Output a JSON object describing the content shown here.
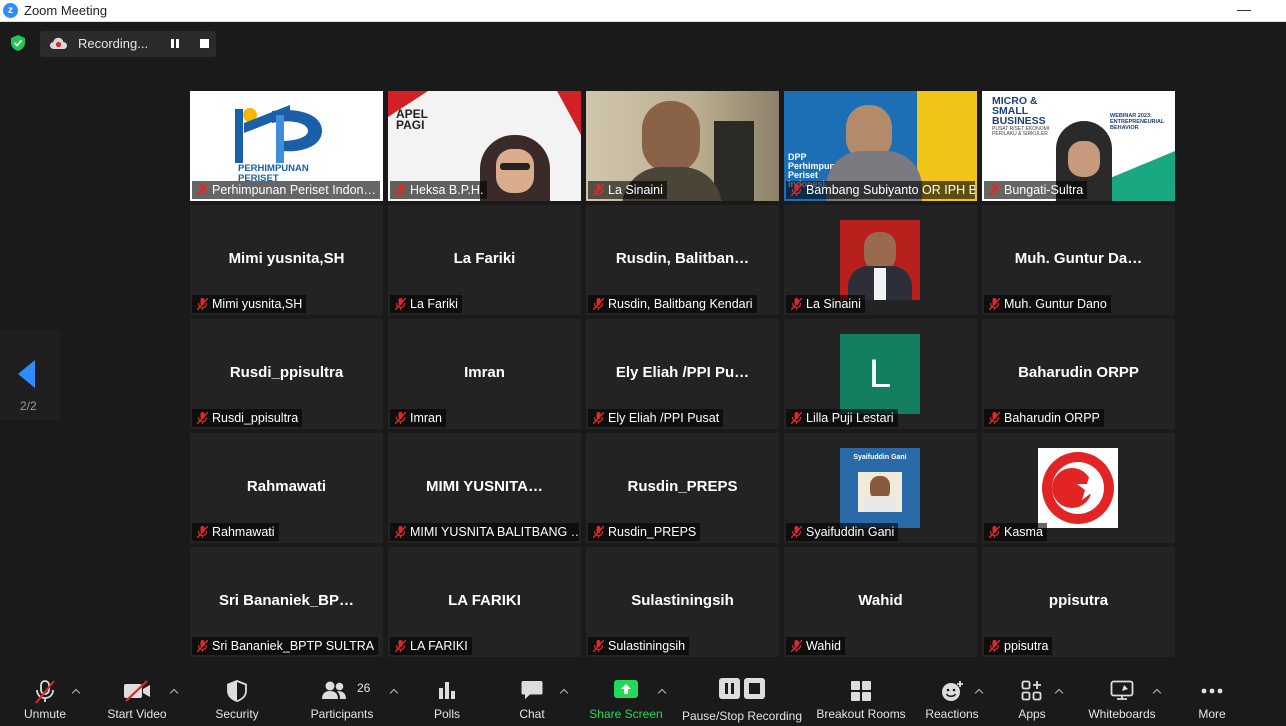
{
  "window": {
    "title": "Zoom Meeting",
    "minimize": "—"
  },
  "recording": {
    "status": "Recording..."
  },
  "pager": {
    "page": "2/2"
  },
  "tiles": [
    {
      "name": "Perhimpunan Periset Indon…",
      "big": ""
    },
    {
      "name": "Heksa B.P.H.",
      "big": ""
    },
    {
      "name": "La Sinaini",
      "big": ""
    },
    {
      "name": "Bambang Subiyanto OR IPH B…",
      "big": ""
    },
    {
      "name": "Bungati-Sultra",
      "big": ""
    },
    {
      "name": "Mimi yusnita,SH",
      "big": "Mimi yusnita,SH"
    },
    {
      "name": "La Fariki",
      "big": "La Fariki"
    },
    {
      "name": "Rusdin, Balitbang Kendari",
      "big": "Rusdin,  Balitban…"
    },
    {
      "name": "La Sinaini",
      "big": ""
    },
    {
      "name": "Muh. Guntur Dano",
      "big": "Muh.  Guntur  Da…"
    },
    {
      "name": "Rusdi_ppisultra",
      "big": "Rusdi_ppisultra"
    },
    {
      "name": "Imran",
      "big": "Imran"
    },
    {
      "name": "Ely Eliah /PPI Pusat",
      "big": "Ely  Eliah  /PPI  Pu…"
    },
    {
      "name": "Lilla Puji Lestari",
      "big": ""
    },
    {
      "name": "Baharudin ORPP",
      "big": "Baharudin ORPP"
    },
    {
      "name": "Rahmawati",
      "big": "Rahmawati"
    },
    {
      "name": "MIMI YUSNITA BALITBANG …",
      "big": "MIMI  YUSNITA…"
    },
    {
      "name": "Rusdin_PREPS",
      "big": "Rusdin_PREPS"
    },
    {
      "name": "Syaifuddin Gani",
      "big": ""
    },
    {
      "name": "Kasma",
      "big": ""
    },
    {
      "name": "Sri Bananiek_BPTP SULTRA",
      "big": "Sri  Bananiek_BP…"
    },
    {
      "name": "LA FARIKI",
      "big": "LA FARIKI"
    },
    {
      "name": "Sulastiningsih",
      "big": "Sulastiningsih"
    },
    {
      "name": "Wahid",
      "big": "Wahid"
    },
    {
      "name": "ppisutra",
      "big": "ppisutra"
    }
  ],
  "slides": {
    "ppi_logo_text": "PERHIMPUNAN PERISET INDONESIA",
    "apel": "APEL PAGI",
    "dpp": "DPP Perhimpunan Periset Indonesia",
    "micro": "MICRO & SMALL BUSINESS",
    "micro_sub": "PUSAT RISET EKONOMI PERILAKU & SIRKULER",
    "webinar": "WEBINAR 2023: ENTREPRENEURIAL BEHAVIOR",
    "book_title": "Syaifuddin Gani",
    "avatar_letter": "L"
  },
  "toolbar": {
    "unmute": "Unmute",
    "start_video": "Start Video",
    "security": "Security",
    "participants": "Participants",
    "participants_count": "26",
    "polls": "Polls",
    "chat": "Chat",
    "share": "Share Screen",
    "recording": "Pause/Stop Recording",
    "breakout": "Breakout Rooms",
    "reactions": "Reactions",
    "apps": "Apps",
    "whiteboards": "Whiteboards",
    "more": "More"
  },
  "colors": {
    "accent": "#2d8cff",
    "share_green": "#23d959",
    "active_speaker": "#f2e66b",
    "muted_red": "#e02828"
  }
}
